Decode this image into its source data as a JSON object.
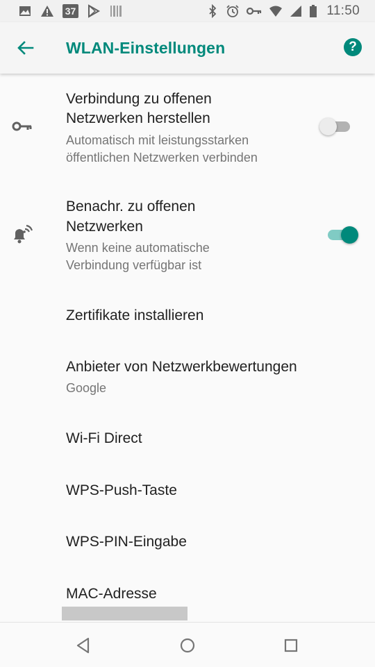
{
  "status_bar": {
    "time": "11:50",
    "notification_badge": "37",
    "left_icons": [
      "image-icon",
      "warning-icon",
      "badge-icon",
      "play-store-icon",
      "barcode-icon"
    ],
    "right_icons": [
      "bluetooth-icon",
      "alarm-icon",
      "vpn-key-icon",
      "wifi-icon",
      "signal-icon",
      "battery-icon"
    ]
  },
  "app_bar": {
    "title": "WLAN-Einstellungen",
    "back_icon": "arrow-back-icon",
    "help_icon": "help-icon",
    "help_glyph": "?",
    "accent_color": "#00897b"
  },
  "settings": {
    "connect_open": {
      "title_line1": "Verbindung zu offenen",
      "title_line2": "Netzwerken herstellen",
      "summary_line1": "Automatisch mit leistungsstarken",
      "summary_line2": "öffentlichen Netzwerken verbinden",
      "icon": "key-icon",
      "enabled": false
    },
    "notify_open": {
      "title_line1": "Benachr. zu offenen",
      "title_line2": "Netzwerken",
      "summary_line1": "Wenn keine automatische",
      "summary_line2": "Verbindung verfügbar ist",
      "icon": "notification-wifi-icon",
      "enabled": true
    },
    "certificates": {
      "title": "Zertifikate installieren"
    },
    "rating_provider": {
      "title": "Anbieter von Netzwerkbewertungen",
      "summary": "Google"
    },
    "wifi_direct": {
      "title": "Wi-Fi Direct"
    },
    "wps_push": {
      "title": "WPS-Push-Taste"
    },
    "wps_pin": {
      "title": "WPS-PIN-Eingabe"
    },
    "mac_address": {
      "title": "MAC-Adresse"
    }
  },
  "nav_bar": {
    "icons": [
      "nav-back-icon",
      "nav-home-icon",
      "nav-recents-icon"
    ]
  }
}
